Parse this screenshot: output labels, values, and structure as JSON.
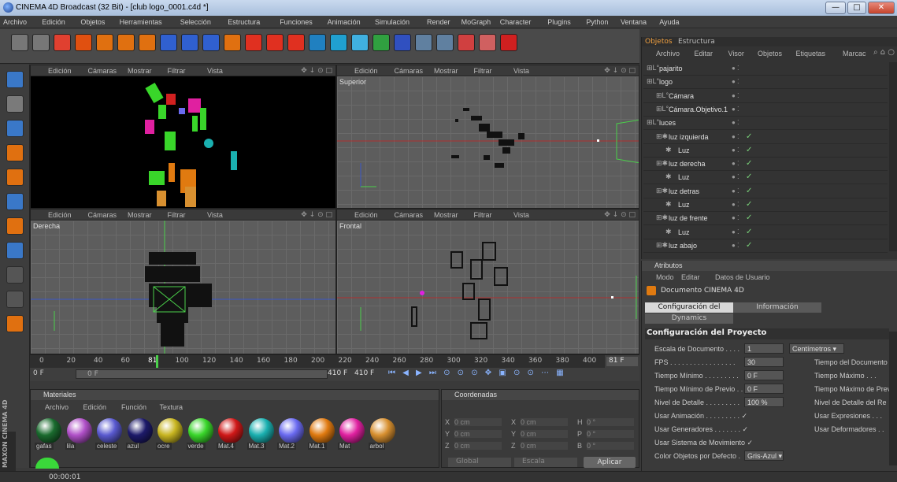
{
  "window": {
    "title": "CINEMA 4D Broadcast (32 Bit) - [club logo_0001.c4d *]",
    "min": "—",
    "max": "□",
    "close": "✕"
  },
  "menu": [
    "Archivo",
    "Edición",
    "Objetos",
    "Herramientas",
    "Selección",
    "Estructura",
    "Funciones",
    "Animación",
    "Simulación",
    "Render",
    "MoGraph",
    "Character",
    "Plugins",
    "Python",
    "Ventana",
    "Ayuda"
  ],
  "viewports": {
    "menu": [
      "Edición",
      "Cámaras",
      "Mostrar",
      "Filtrar",
      "Vista"
    ],
    "names": {
      "tl": "",
      "tr": "Superior",
      "bl": "Derecha",
      "br": "Frontal"
    }
  },
  "timeline": {
    "ticks": [
      "0",
      "20",
      "40",
      "60",
      "81",
      "100",
      "120",
      "140",
      "160",
      "180",
      "200",
      "220",
      "240",
      "260",
      "280",
      "300",
      "320",
      "340",
      "360",
      "380",
      "400"
    ],
    "current": "81 F",
    "start": "0 F",
    "range_start": "0 F",
    "range_end": "410 F",
    "end": "410 F"
  },
  "materials": {
    "title": "Materiales",
    "menu": [
      "Archivo",
      "Edición",
      "Función",
      "Textura"
    ],
    "items": [
      {
        "label": "gafas",
        "color": "#1a6b2e"
      },
      {
        "label": "lila",
        "color": "#b050c8"
      },
      {
        "label": "celeste",
        "color": "#5a5ad0"
      },
      {
        "label": "azul",
        "color": "#1d1a6a"
      },
      {
        "label": "ocre",
        "color": "#c8b520"
      },
      {
        "label": "verde",
        "color": "#39d62a"
      },
      {
        "label": "Mat.4",
        "color": "#d01818"
      },
      {
        "label": "Mat.3",
        "color": "#1ab0b0"
      },
      {
        "label": "Mat.2",
        "color": "#6a6af0"
      },
      {
        "label": "Mat.1",
        "color": "#e07a10"
      },
      {
        "label": "Mat",
        "color": "#e020a0"
      },
      {
        "label": "arbol",
        "color": "#d89030"
      }
    ],
    "extra_color": "#3ad83a"
  },
  "coords": {
    "title": "Coordenadas",
    "rows": [
      {
        "a": "X",
        "av": "0 cm",
        "b": "X",
        "bv": "0 cm",
        "c": "H",
        "cv": "0 °"
      },
      {
        "a": "Y",
        "av": "0 cm",
        "b": "Y",
        "bv": "0 cm",
        "c": "P",
        "cv": "0 °"
      },
      {
        "a": "Z",
        "av": "0 cm",
        "b": "Z",
        "bv": "0 cm",
        "c": "B",
        "cv": "0 °"
      }
    ],
    "mode1": "Global",
    "mode2": "Escala",
    "apply": "Aplicar"
  },
  "objects": {
    "tabs": [
      "Objetos",
      "Estructura"
    ],
    "menu": [
      "Archivo",
      "Editar",
      "Visor",
      "Objetos",
      "Etiquetas",
      "Marcac"
    ],
    "items": [
      {
        "name": "pajarito",
        "indent": 0,
        "check": ""
      },
      {
        "name": "logo",
        "indent": 0,
        "check": ""
      },
      {
        "name": "Cámara",
        "indent": 1,
        "check": ""
      },
      {
        "name": "Cámara.Objetivo.1",
        "indent": 1,
        "check": ""
      },
      {
        "name": "luces",
        "indent": 0,
        "check": ""
      },
      {
        "name": "luz izquierda",
        "indent": 1,
        "check": "✓"
      },
      {
        "name": "Luz",
        "indent": 2,
        "check": "✓"
      },
      {
        "name": "luz derecha",
        "indent": 1,
        "check": "✓"
      },
      {
        "name": "Luz",
        "indent": 2,
        "check": "✓"
      },
      {
        "name": "luz detras",
        "indent": 1,
        "check": "✓"
      },
      {
        "name": "Luz",
        "indent": 2,
        "check": "✓"
      },
      {
        "name": "luz de frente",
        "indent": 1,
        "check": "✓"
      },
      {
        "name": "Luz",
        "indent": 2,
        "check": "✓"
      },
      {
        "name": "luz abajo",
        "indent": 1,
        "check": "✓"
      }
    ]
  },
  "attributes": {
    "title": "Atributos",
    "menu": [
      "Modo",
      "Editar",
      "Datos de Usuario"
    ],
    "doc": "Documento CINEMA 4D",
    "tabs": [
      "Configuración del Proyecto",
      "Información",
      "Dynamics"
    ],
    "section": "Configuración del Proyecto",
    "rows": [
      {
        "label": "Escala de Documento . . . .",
        "value": "1",
        "extra": "Centímetros ▾",
        "right": ""
      },
      {
        "label": "FPS . . . . . . . . . . . . . . . . .",
        "value": "30",
        "extra": "",
        "right": "Tiempo del Documento"
      },
      {
        "label": "Tiempo Mínimo . . . . . . . . .",
        "value": "0 F",
        "extra": "",
        "right": "Tiempo Máximo . . ."
      },
      {
        "label": "Tiempo Mínimo de Previo . .",
        "value": "0 F",
        "extra": "",
        "right": "Tiempo Máximo de Prev"
      },
      {
        "label": "Nivel de Detalle . . . . . . . . .",
        "value": "100 %",
        "extra": "",
        "right": "Nivel de Detalle del Re"
      },
      {
        "label": "Usar Animación . . . . . . . . . ✓",
        "value": "",
        "extra": "",
        "right": "Usar Expresiones . . ."
      },
      {
        "label": "Usar Generadores . . . . . . . ✓",
        "value": "",
        "extra": "",
        "right": "Usar Deformadores . ."
      },
      {
        "label": "Usar Sistema de Movimiento ✓",
        "value": "",
        "extra": "",
        "right": ""
      },
      {
        "label": "Color Objetos por Defecto .",
        "value": "Gris-Azul ▾",
        "extra": "",
        "right": ""
      }
    ]
  },
  "status": {
    "time": "00:00:01"
  },
  "brand": "MAXON CINEMA 4D"
}
